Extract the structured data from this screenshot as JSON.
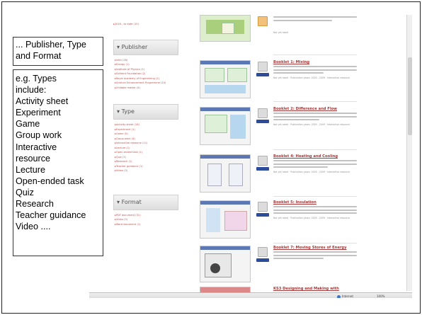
{
  "callouts": {
    "publisher_type_format": "... Publisher, Type and Format",
    "types_lines": [
      "e.g. Types",
      "include:",
      "Activity sheet",
      "Experiment",
      "Game",
      "Group work",
      "Interactive",
      "resource",
      "Lecture",
      "Open-ended task",
      "Quiz",
      "Research",
      "Teacher guidance",
      "Video ...."
    ]
  },
  "sidebar": {
    "top_item": "2016 - to date (10)",
    "facets": [
      {
        "title": "Publisher",
        "items": [
          "Intel (16)",
          "Energy (1)",
          "Institute of Physics (1)",
          "Sutherd Foundation (2)",
          "Royal Academy of Engineering (1)",
          "Science Enhancement Programme (10)",
          "Unilable matter (4)"
        ]
      },
      {
        "title": "Type",
        "items": [
          "Activity sheet (16)",
          "Experiment (1)",
          "Game (5)",
          "Group work (4)",
          "Interactive resource (11)",
          "Lecture (1)",
          "Open-ended task (1)",
          "Quiz (1)",
          "Research (1)",
          "Teacher guidance (1)",
          "Video (3)"
        ]
      },
      {
        "title": "Format",
        "items": [
          "PDF document (31)",
          "Video (3)",
          "Word document (1)"
        ]
      }
    ]
  },
  "results": [
    {
      "title": "",
      "meta": "Not yet rated"
    },
    {
      "title": "Booklet 1: Mixing",
      "meta": "Not yet rated · Publication years: 2005 - 2009 · Interactive resource"
    },
    {
      "title": "Booklet 2: Difference and Flow",
      "meta": "Not yet rated · Publication years: 2005 - 2009 · Interactive resource"
    },
    {
      "title": "Booklet 4: Heating and Cooling",
      "meta": "Not yet rated · Publication years: 2005 - 2009 · Interactive resource"
    },
    {
      "title": "Booklet 5: Insulation",
      "meta": "Not yet rated · Publication years: 2005 - 2009 · Interactive resource"
    },
    {
      "title": "Booklet 7: Moving Stores of Energy",
      "meta": ""
    },
    {
      "title": "KS3 Designing and Making with",
      "meta": ""
    }
  ],
  "status": {
    "zone": "Internet",
    "zoom": "100%"
  }
}
